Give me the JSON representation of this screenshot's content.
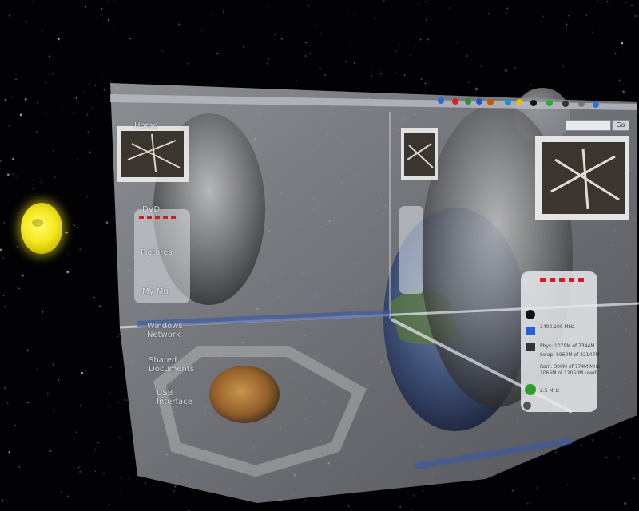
{
  "desktop_icons": [
    {
      "name": "home",
      "label": "Home"
    },
    {
      "name": "dvd",
      "label": "DVD"
    },
    {
      "name": "pictures",
      "label": "Pictures"
    },
    {
      "name": "my-music",
      "label": "My Mu"
    },
    {
      "name": "windows-network",
      "label": "Windows Network"
    },
    {
      "name": "shared-documents",
      "label": "Shared Documents"
    },
    {
      "name": "usb-interface",
      "label": "USB Interface"
    }
  ],
  "search": {
    "go_label": "Go"
  },
  "system_monitor": {
    "cpu": "2400.100 MHz",
    "phys": "Phys: 1079M of 7344M",
    "swap": "Swap: 5960M of 22147M",
    "ram_lines": [
      "Rom: 300M of 774M MHz",
      "1066M of 12050M used"
    ],
    "battery": "2.5 MHz"
  },
  "colors": {
    "space": "#020204",
    "pane_tint": "#8c8f96",
    "taskbar": "#3c5aa0",
    "sun": "#f4e81e"
  }
}
